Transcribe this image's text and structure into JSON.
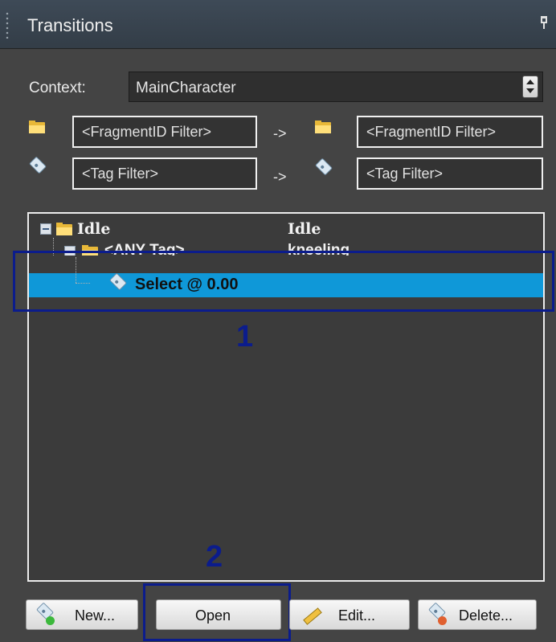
{
  "window": {
    "title": "Transitions"
  },
  "context": {
    "label": "Context:",
    "value": "MainCharacter"
  },
  "filters": {
    "fragment_from": "<FragmentID Filter>",
    "fragment_to": "<FragmentID Filter>",
    "tag_from": "<Tag Filter>",
    "tag_to": "<Tag Filter>",
    "arrow": "->"
  },
  "tree": {
    "rows": [
      {
        "name": "Idle",
        "value": "Idle"
      },
      {
        "name": "<ANY Tag>",
        "value": "kneeling"
      },
      {
        "name": "Select @  0.00"
      }
    ]
  },
  "annotations": {
    "one": "1",
    "two": "2"
  },
  "buttons": {
    "new": "New...",
    "open": "Open",
    "edit": "Edit...",
    "delete": "Delete..."
  },
  "colors": {
    "selection": "#0f98d8",
    "annotation": "#0b1c8c",
    "panel": "#444444"
  }
}
